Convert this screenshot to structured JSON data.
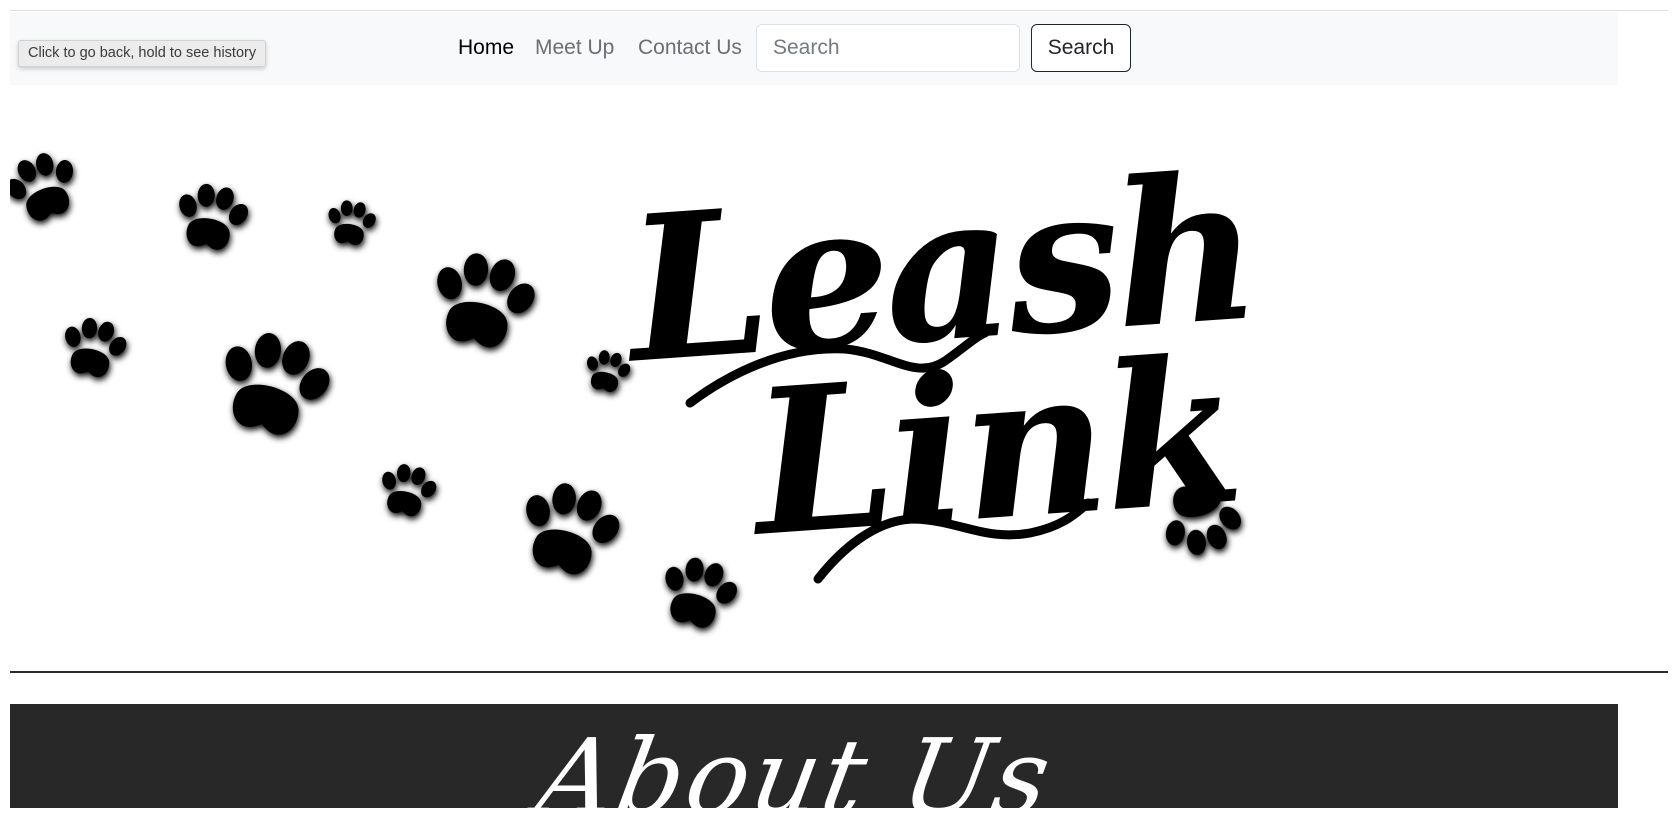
{
  "browser": {
    "back_tooltip": "Click to go back, hold to see history"
  },
  "nav": {
    "links": [
      "Home",
      "Meet Up",
      "Contact Us"
    ],
    "active": "Home",
    "search": {
      "placeholder": "Search",
      "button_label": "Search"
    }
  },
  "hero": {
    "logo_line1": "Leash",
    "logo_line2": "Link",
    "logo_icon": "paw-prints-icon"
  },
  "about": {
    "title": "About Us"
  },
  "colors": {
    "navbar_bg": "#f8f9fa",
    "about_bg": "#282828",
    "text_dark": "#000000",
    "text_muted": "#6b6f73"
  }
}
